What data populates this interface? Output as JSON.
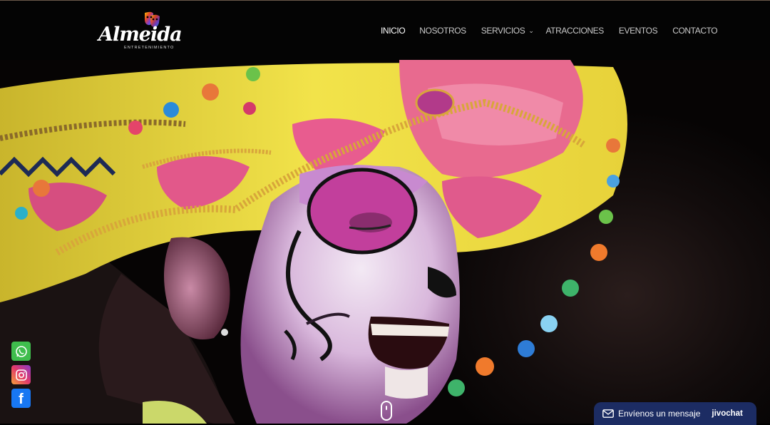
{
  "header": {
    "logo_text": "Almeida",
    "logo_tagline": "ENTRETENIMIENTO",
    "nav": [
      {
        "label": "INICIO",
        "active": true
      },
      {
        "label": "NOSOTROS"
      },
      {
        "label": "SERVICIOS",
        "dropdown": true
      },
      {
        "label": "ATRACCIONES"
      },
      {
        "label": "EVENTOS"
      },
      {
        "label": "CONTACTO"
      }
    ]
  },
  "social": [
    {
      "icon": "whatsapp-icon",
      "color": "#3fbd4d"
    },
    {
      "icon": "instagram-icon",
      "color": "#c1358f"
    },
    {
      "icon": "facebook-icon",
      "color": "#1877f2"
    }
  ],
  "chat": {
    "label": "Envíenos un mensaje",
    "brand": "jivochat",
    "color": "#1c2c63"
  },
  "colors": {
    "header_bg": "#040404",
    "nav_text": "#c9c9c9",
    "nav_active": "#ffffff"
  }
}
